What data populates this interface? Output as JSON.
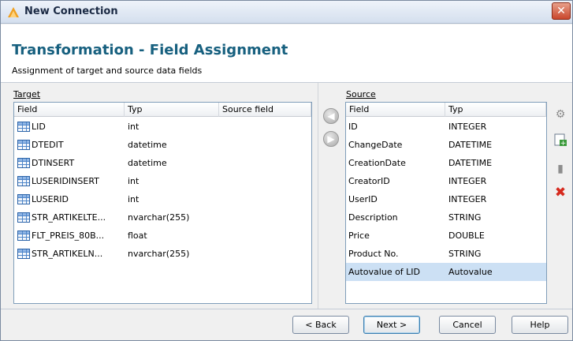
{
  "window": {
    "title": "New Connection",
    "close_symbol": "✕"
  },
  "header": {
    "title": "Transformation - Field Assignment",
    "subtitle": "Assignment of target and source data fields"
  },
  "target": {
    "label": "Target",
    "columns": [
      "Field",
      "Typ",
      "Source field"
    ],
    "rows": [
      {
        "field": "LID",
        "typ": "int",
        "source": ""
      },
      {
        "field": "DTEDIT",
        "typ": "datetime",
        "source": ""
      },
      {
        "field": "DTINSERT",
        "typ": "datetime",
        "source": ""
      },
      {
        "field": "LUSERIDINSERT",
        "typ": "int",
        "source": ""
      },
      {
        "field": "LUSERID",
        "typ": "int",
        "source": ""
      },
      {
        "field": "STR_ARTIKELTE...",
        "typ": "nvarchar(255)",
        "source": ""
      },
      {
        "field": "FLT_PREIS_80B...",
        "typ": "float",
        "source": ""
      },
      {
        "field": "STR_ARTIKELN...",
        "typ": "nvarchar(255)",
        "source": ""
      }
    ]
  },
  "source": {
    "label": "Source",
    "columns": [
      "Field",
      "Typ"
    ],
    "rows": [
      {
        "field": "ID",
        "typ": "INTEGER"
      },
      {
        "field": "ChangeDate",
        "typ": "DATETIME"
      },
      {
        "field": "CreationDate",
        "typ": "DATETIME"
      },
      {
        "field": "CreatorID",
        "typ": "INTEGER"
      },
      {
        "field": "UserID",
        "typ": "INTEGER"
      },
      {
        "field": "Description",
        "typ": "STRING"
      },
      {
        "field": "Price",
        "typ": "DOUBLE"
      },
      {
        "field": "Product No.",
        "typ": "STRING"
      },
      {
        "field": "Autovalue of LID",
        "typ": "Autovalue"
      }
    ],
    "selected_index": 8
  },
  "arrows": {
    "assign_left": "◀",
    "assign_right": "▶"
  },
  "tools": {
    "gear": "⚙",
    "add": "+",
    "page": "▮",
    "delete": "✖"
  },
  "buttons": {
    "back": "< Back",
    "next": "Next >",
    "cancel": "Cancel",
    "help": "Help"
  },
  "colors": {
    "title_accent": "#17607f",
    "selection": "#cce0f4",
    "delete_red": "#d62a1e"
  }
}
